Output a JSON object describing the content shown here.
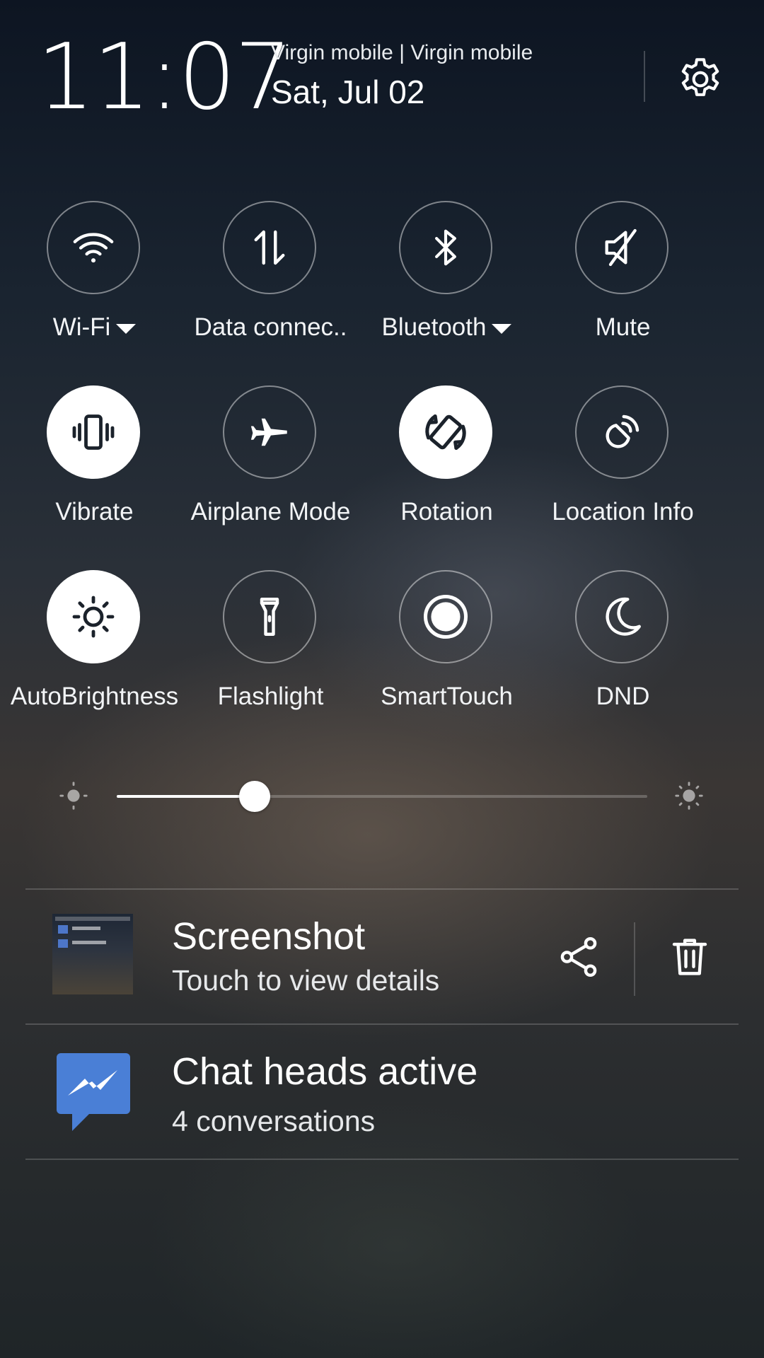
{
  "header": {
    "time": "11:07",
    "carrier": "Virgin mobile | Virgin mobile",
    "date": "Sat, Jul 02",
    "settings_icon": "gear-icon"
  },
  "toggles": [
    {
      "label": "Wi-Fi",
      "icon": "wifi-icon",
      "active": false,
      "has_dropdown": true
    },
    {
      "label": "Data connec..",
      "icon": "data-arrows-icon",
      "active": false,
      "has_dropdown": false
    },
    {
      "label": "Bluetooth",
      "icon": "bluetooth-icon",
      "active": false,
      "has_dropdown": true
    },
    {
      "label": "Mute",
      "icon": "speaker-muted-icon",
      "active": false,
      "has_dropdown": false
    },
    {
      "label": "Vibrate",
      "icon": "vibrate-icon",
      "active": true,
      "has_dropdown": false
    },
    {
      "label": "Airplane Mode",
      "icon": "airplane-icon",
      "active": false,
      "has_dropdown": false
    },
    {
      "label": "Rotation",
      "icon": "rotation-icon",
      "active": true,
      "has_dropdown": false
    },
    {
      "label": "Location Info",
      "icon": "location-icon",
      "active": false,
      "has_dropdown": false
    },
    {
      "label": "AutoBrightness",
      "icon": "sun-icon",
      "active": true,
      "has_dropdown": false
    },
    {
      "label": "Flashlight",
      "icon": "flashlight-icon",
      "active": false,
      "has_dropdown": false
    },
    {
      "label": "SmartTouch",
      "icon": "smarttouch-icon",
      "active": false,
      "has_dropdown": false
    },
    {
      "label": "DND",
      "icon": "moon-icon",
      "active": false,
      "has_dropdown": false
    }
  ],
  "brightness": {
    "level": 0.26,
    "min_icon": "brightness-low-icon",
    "max_icon": "brightness-high-icon"
  },
  "notifications": [
    {
      "title": "Screenshot",
      "subtitle": "Touch to view details",
      "icon": "screenshot-thumbnail",
      "actions": [
        "share-icon",
        "trash-icon"
      ]
    },
    {
      "title": "Chat heads active",
      "subtitle": "4 conversations",
      "icon": "messenger-icon",
      "icon_color": "#4a7fd6"
    }
  ],
  "colors": {
    "active_tile": "#ffffff",
    "messenger_blue": "#4a7fd6"
  }
}
